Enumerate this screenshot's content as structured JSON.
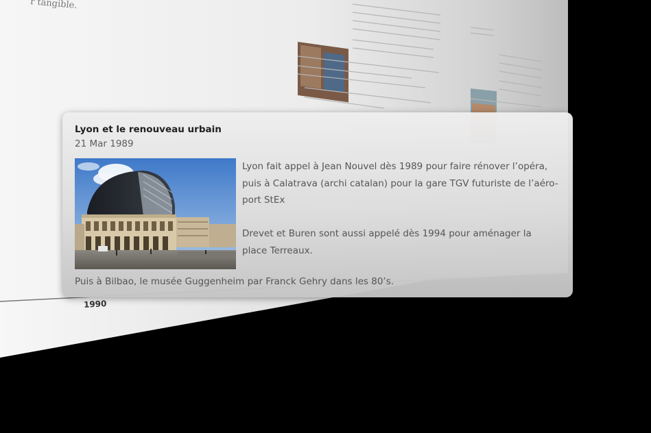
{
  "background": {
    "visible_fragments": [
      "r tangible.",
      "1990"
    ],
    "colors": {
      "page_bg": "#000000",
      "sheet_light": "#f4f4f4",
      "sheet_dark": "#c8c8c8"
    }
  },
  "event_popover": {
    "title": "Lyon et le renouveau urbain",
    "date": "21 Mar 1989",
    "image_icon": "opera-de-lyon-photo",
    "paragraphs": [
      "Lyon fait appel à Jean Nouvel dès 1989 pour faire rénover l’opéra, puis à Calatrava (archi catalan) pour la gare TGV futuriste de l’aéro-port StEx",
      "Drevet et Buren sont aussi appelé dès 1994 pour aménager la place Terreaux."
    ],
    "footer": "Puis à Bilbao, le musée Guggenheim par Franck Gehry dans les 80’s."
  }
}
